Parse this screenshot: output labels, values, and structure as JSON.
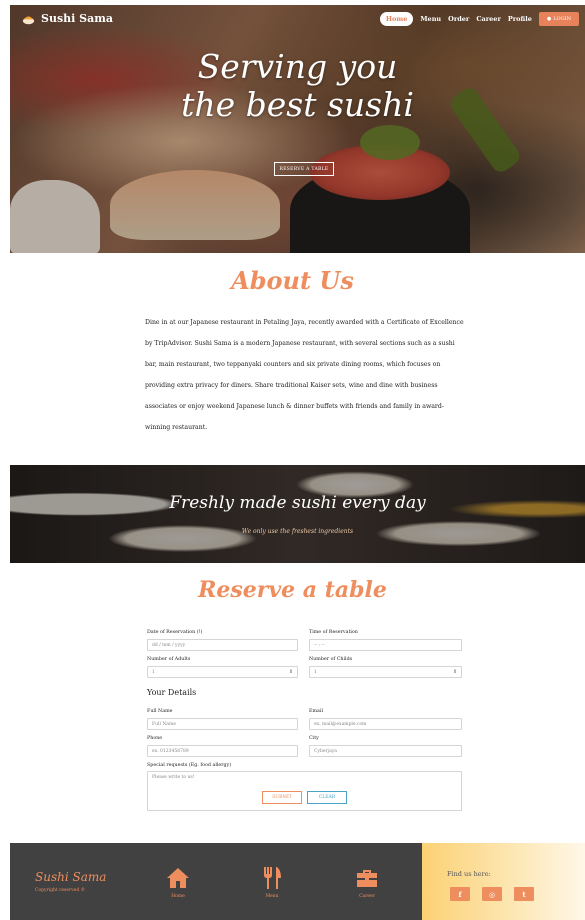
{
  "nav": {
    "brand": "Sushi Sama",
    "items": [
      {
        "label": "Home",
        "active": true
      },
      {
        "label": "Menu"
      },
      {
        "label": "Order"
      },
      {
        "label": "Career"
      },
      {
        "label": "Profile"
      }
    ],
    "login_label": "LOGIN"
  },
  "hero": {
    "title_line1": "Serving you",
    "title_line2": "the best sushi",
    "button_label": "RESERVE A TABLE"
  },
  "about": {
    "title": "About Us",
    "text": "Dine in at our Japanese restaurant in Petaling Jaya, recently awarded with a Certificate of Excellence by TripAdvisor. Sushi Sama is a modern Japanese restaurant, with several sections such as a sushi bar, main restaurant, two teppanyaki counters and six private dining rooms, which focuses on providing extra privacy for diners. Share traditional Kaiser sets, wine and dine with business associates or enjoy weekend Japanese lunch & dinner buffets with friends and family in award-winning restaurant."
  },
  "banner": {
    "title": "Freshly made sushi every day",
    "subtitle": "We only use the freshest ingredients"
  },
  "reserve": {
    "title": "Reserve a table",
    "date_label": "Date of Reservation (!)",
    "date_placeholder": "dd / mm / yyyy",
    "time_label": "Time of Reservation",
    "time_placeholder": "-- : --",
    "adults_label": "Number of Adults",
    "adults_value": "1",
    "children_label": "Number of Childs",
    "children_value": "1",
    "details_heading": "Your Details",
    "fullname_label": "Full Name",
    "fullname_placeholder": "Full Name",
    "email_label": "Email",
    "email_placeholder": "ex. mail@example.com",
    "phone_label": "Phone",
    "phone_placeholder": "ex. 0123456789",
    "city_label": "City",
    "city_placeholder": "Cyberjaya",
    "requests_label": "Special requests (Eg. food allergy)",
    "requests_placeholder": "Please write to us!",
    "submit_label": "SUBMIT",
    "clear_label": "CLEAR"
  },
  "footer": {
    "brand": "Sushi Sama",
    "copyright": "Copyright reserved ©",
    "links": [
      {
        "label": "Home",
        "icon": "home-icon"
      },
      {
        "label": "Menu",
        "icon": "utensils-icon"
      },
      {
        "label": "Career",
        "icon": "briefcase-icon"
      }
    ],
    "find_label": "Find us here:",
    "social": [
      {
        "label": "f",
        "icon": "facebook-icon"
      },
      {
        "label": "◎",
        "icon": "instagram-icon"
      },
      {
        "label": "t",
        "icon": "twitter-icon"
      }
    ]
  },
  "colors": {
    "accent": "#ee8e5f",
    "footer_bg": "#414141",
    "clear_button": "#49a3c9"
  }
}
